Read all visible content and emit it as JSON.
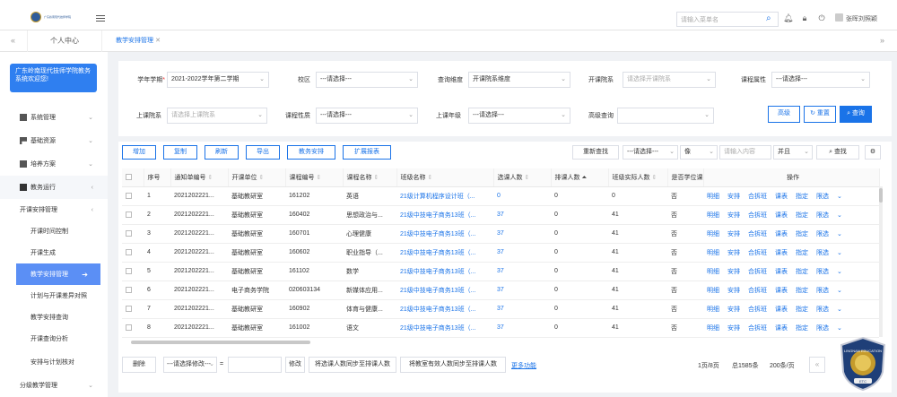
{
  "header": {
    "logo_text": "广东岭南现代技师学院",
    "search_placeholder": "请输入菜单名",
    "user_name": "张晖刘照颖"
  },
  "tabs": {
    "home": "个人中心",
    "active": "教学安排管理"
  },
  "sidebar": {
    "school_title": "广东岭南现代技师学院教务系统欢迎您!",
    "items": [
      {
        "label": "系统管理"
      },
      {
        "label": "基础资源"
      },
      {
        "label": "培养方案"
      },
      {
        "label": "教务运行"
      },
      {
        "label": "开课安排管理"
      },
      {
        "label": "开课时间控制"
      },
      {
        "label": "开课生成"
      },
      {
        "label": "教学安排管理"
      },
      {
        "label": "计划与开课差异对照"
      },
      {
        "label": "教学安排查询"
      },
      {
        "label": "开课查询分析"
      },
      {
        "label": "安排与计划核对"
      },
      {
        "label": "分级教学管理"
      }
    ]
  },
  "filters": {
    "term_label": "学年学期",
    "term_value": "2021-2022学年第二学期",
    "campus_label": "校区",
    "campus_value": "---请选择---",
    "dim_label": "查询维度",
    "dim_value": "开课院系维度",
    "dept_label": "开课院系",
    "dept_placeholder": "请选择开课院系",
    "attr_label": "课程属性",
    "attr_value": "---请选择---",
    "class_dept_label": "上课院系",
    "class_dept_placeholder": "请选择上课院系",
    "nature_label": "课程性质",
    "nature_value": "---请选择---",
    "grade_label": "上课年级",
    "grade_value": "---请选择---",
    "adv_label": "高级查询",
    "advanced_btn": "高级",
    "reset_btn": "重置",
    "search_btn": "查询"
  },
  "toolbar": {
    "buttons": [
      "增加",
      "复制",
      "刷新",
      "导出",
      "教务安排",
      "扩展报表"
    ],
    "requery": "重新查找",
    "field_select": "---请选择---",
    "op_select": "像",
    "content_placeholder": "请输入内容",
    "join_select": "并且",
    "find": "查找"
  },
  "table": {
    "columns": [
      "序号",
      "通知单编号",
      "开课单位",
      "课程编号",
      "课程名称",
      "班级名称",
      "选课人数",
      "排课人数",
      "班级实际人数",
      "是否学位课",
      "操作"
    ],
    "ops": [
      "明细",
      "安排",
      "合拆班",
      "课表",
      "指定",
      "限选"
    ],
    "rows": [
      {
        "no": "1",
        "notice": "2021202221...",
        "unit": "基础教研室",
        "code": "161202",
        "course": "英语",
        "class": "21级计算机程序设计班（...",
        "selected": "0",
        "scheduled": "0",
        "actual": "0",
        "degree": "否"
      },
      {
        "no": "2",
        "notice": "2021202221...",
        "unit": "基础教研室",
        "code": "160402",
        "course": "思想政治与...",
        "class": "21级中技电子商务13班（...",
        "selected": "37",
        "scheduled": "0",
        "actual": "41",
        "degree": "否"
      },
      {
        "no": "3",
        "notice": "2021202221...",
        "unit": "基础教研室",
        "code": "160701",
        "course": "心理健康",
        "class": "21级中技电子商务13班（...",
        "selected": "37",
        "scheduled": "0",
        "actual": "41",
        "degree": "否"
      },
      {
        "no": "4",
        "notice": "2021202221...",
        "unit": "基础教研室",
        "code": "160602",
        "course": "职业指导（...",
        "class": "21级中技电子商务13班（...",
        "selected": "37",
        "scheduled": "0",
        "actual": "41",
        "degree": "否"
      },
      {
        "no": "5",
        "notice": "2021202221...",
        "unit": "基础教研室",
        "code": "161102",
        "course": "数学",
        "class": "21级中技电子商务13班（...",
        "selected": "37",
        "scheduled": "0",
        "actual": "41",
        "degree": "否"
      },
      {
        "no": "6",
        "notice": "2021202221...",
        "unit": "电子商务学院",
        "code": "020603134",
        "course": "新媒体应用...",
        "class": "21级中技电子商务13班（...",
        "selected": "37",
        "scheduled": "0",
        "actual": "41",
        "degree": "否"
      },
      {
        "no": "7",
        "notice": "2021202221...",
        "unit": "基础教研室",
        "code": "160902",
        "course": "体育与健康...",
        "class": "21级中技电子商务13班（...",
        "selected": "37",
        "scheduled": "0",
        "actual": "41",
        "degree": "否"
      },
      {
        "no": "8",
        "notice": "2021202221...",
        "unit": "基础教研室",
        "code": "161002",
        "course": "语文",
        "class": "21级中技电子商务13班（...",
        "selected": "37",
        "scheduled": "0",
        "actual": "41",
        "degree": "否"
      }
    ]
  },
  "footer": {
    "delete": "删除",
    "batch_select": "---请选择修改---",
    "eq": "=",
    "modify": "修改",
    "sync_selected": "将选课人数同步至排课人数",
    "sync_valid": "将教室有效人数同步至排课人数",
    "more": "更多功能",
    "page": "1页/8页",
    "total": "总1585条",
    "per_page": "200条/页"
  },
  "badge": {
    "text": "LINGNAN EDUCATION",
    "sub": "ETC"
  }
}
